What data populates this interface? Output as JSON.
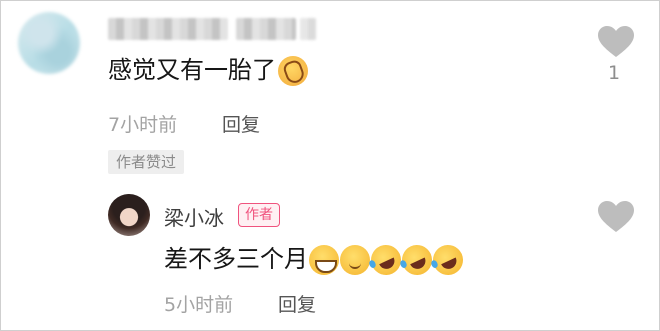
{
  "comment": {
    "text": "感觉又有一胎了",
    "emoji": "clapping-hands-icon",
    "time": "7小时前",
    "reply_label": "回复",
    "like_count": "1",
    "author_liked_tag": "作者赞过"
  },
  "reply": {
    "name": "梁小冰",
    "author_badge": "作者",
    "text": "差不多三个月",
    "emojis": [
      "grinning-face-icon",
      "smirking-face-icon",
      "rolling-laughing-icon",
      "rolling-laughing-icon",
      "rolling-laughing-icon"
    ],
    "time": "5小时前",
    "reply_label": "回复"
  },
  "colors": {
    "author_badge": "#f0537e",
    "muted_text": "#a3a3a3",
    "heart": "#bdbdbd"
  }
}
